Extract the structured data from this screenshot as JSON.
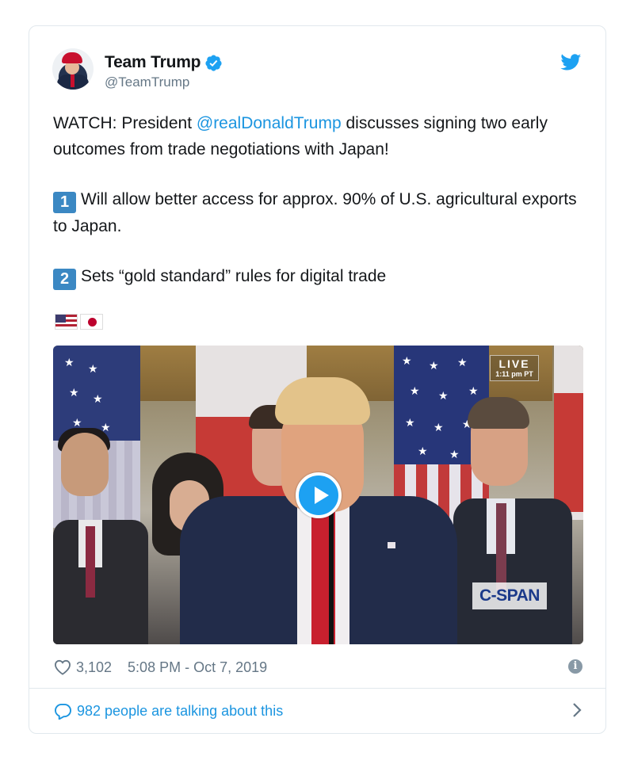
{
  "tweet": {
    "display_name": "Team Trump",
    "handle": "@TeamTrump",
    "verified": true,
    "text": {
      "intro_before_mention": "WATCH: President ",
      "mention": "@realDonaldTrump",
      "intro_after_mention": " discusses signing two early outcomes from trade negotiations with Japan!",
      "point_1_number": "1",
      "point_1": "Will allow better access for approx. 90% of U.S. agricultural exports to Japan.",
      "point_2_number": "2",
      "point_2": "Sets “gold standard” rules for digital trade"
    },
    "flags": [
      "us-flag",
      "japan-flag"
    ]
  },
  "video": {
    "live_label": "LIVE",
    "live_time": "1:11 pm PT",
    "network_logo": "C-SPAN",
    "play_icon": "play-icon"
  },
  "meta": {
    "likes": "3,102",
    "timestamp": "5:08 PM - Oct 7, 2019",
    "info_icon": "info-icon"
  },
  "footer": {
    "talking_text": "982 people are talking about this"
  },
  "colors": {
    "link": "#1b95e0",
    "twitter_blue": "#1da1f2",
    "secondary_text": "#657786",
    "border": "#e1e8ed",
    "keycap": "#3b88c3"
  }
}
